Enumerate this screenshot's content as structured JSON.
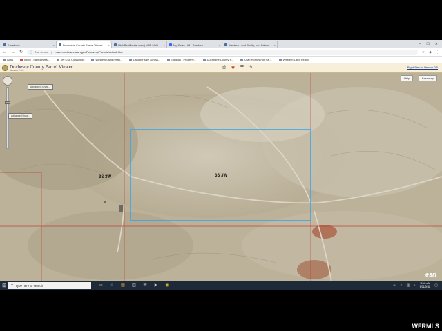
{
  "browser": {
    "tabs": [
      {
        "label": "Facebook",
        "active": false
      },
      {
        "label": "Duchesne County Parcel Viewer",
        "active": true
      },
      {
        "label": "UtahRealEstate.com | NPR Multi...",
        "active": false
      },
      {
        "label": "My Show - All - Pandora",
        "active": false
      },
      {
        "label": "Western Land Realty, Inc. Admin",
        "active": false
      }
    ],
    "address": {
      "security": "Not secure",
      "url": "maps.duchesne.utah.gov/Recovery/Parcels/default.htm"
    },
    "bookmarks": [
      "Apps",
      "Inbox - garet@wes...",
      "My KSL Classifieds",
      "Western Land Realt...",
      "Land for sale across...",
      "Listings - Property...",
      "Duchesne County P...",
      "Utah Homes For Sal...",
      "Western Land Realty"
    ]
  },
  "app": {
    "title": "Duchesne County Parcel Viewer",
    "version": "Version 2.5.0",
    "help_link": "Right Step to Version 2.5"
  },
  "map": {
    "buttons": {
      "help": "Help",
      "basemap": "Basemap"
    },
    "tool_labels": [
      "Advanced Searc...",
      "Advanced Draw..."
    ],
    "parcel_labels": [
      "3S 3W",
      "3S 3W"
    ],
    "esri": "esri",
    "selection_color": "#3aa4e8",
    "boundary_color": "#c0392b"
  },
  "taskbar": {
    "search_placeholder": "Type here to search",
    "time": "11:41 AM",
    "date": "6/21/2018"
  },
  "watermark": "WFRMLS"
}
